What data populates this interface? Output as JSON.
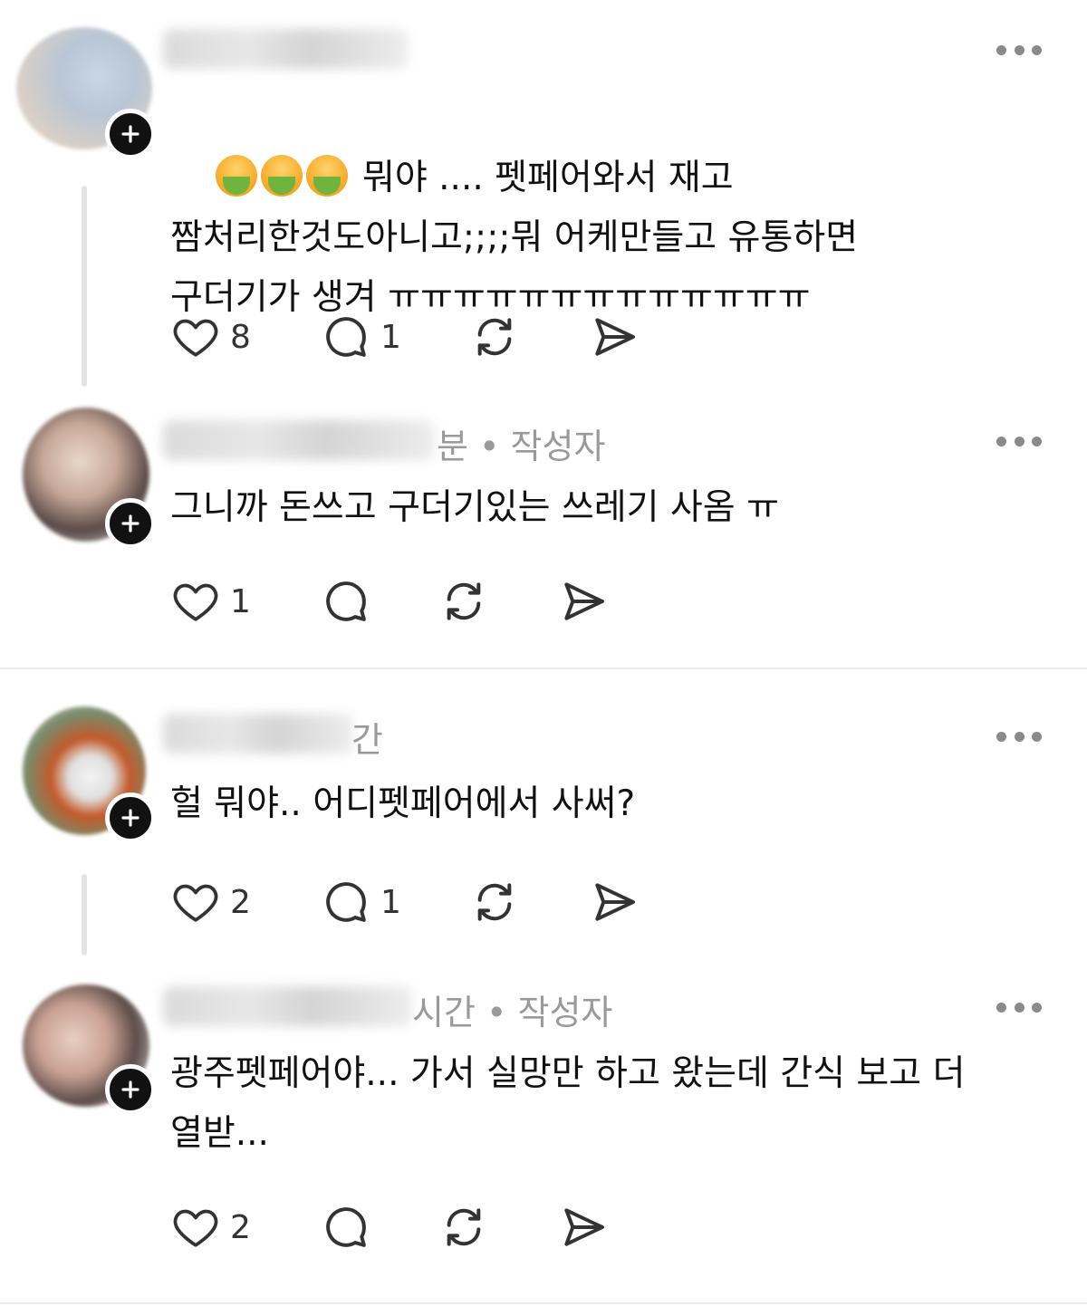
{
  "posts": [
    {
      "meta": "",
      "text_line1_suffix": " 뭐야 .... 펫페어와서 재고",
      "text_rest": "짬처리한것도아니고;;;;뭐 어케만들고 유통하면\n구더기가 생겨 ㅠㅠㅠㅠㅠㅠㅠㅠㅠㅠㅠㅠㅠ",
      "likes": "8",
      "replies": "1",
      "emoji": [
        "nauseated-face-icon",
        "nauseated-face-icon",
        "nauseated-face-icon"
      ]
    },
    {
      "meta": "분 • 작성자",
      "text": "그니까 돈쓰고 구더기있는 쓰레기 사옴 ㅠ",
      "likes": "1",
      "replies": ""
    },
    {
      "meta": "간",
      "text": "헐 뭐야.. 어디펫페어에서 사써?",
      "likes": "2",
      "replies": "1"
    },
    {
      "meta": "시간 • 작성자",
      "text": "광주펫페어야... 가서 실망만 하고 왔는데 간식 보고 더\n열받...",
      "likes": "2",
      "replies": ""
    }
  ],
  "colors": {
    "text": "#111111",
    "meta": "#9a9a9a",
    "icon": "#333333",
    "thread_line": "#e4e4e4",
    "follow_badge": "#111111"
  }
}
